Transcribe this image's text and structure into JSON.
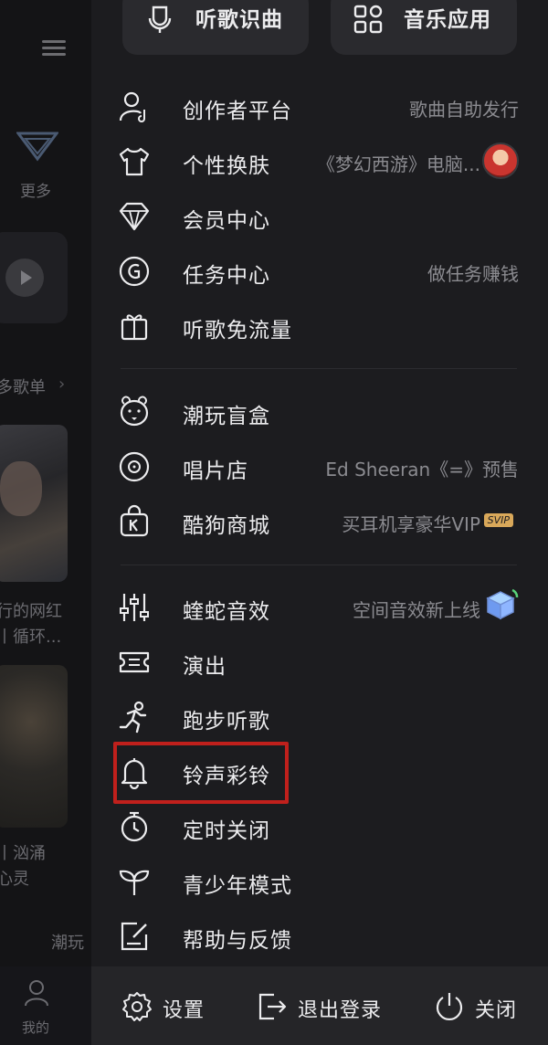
{
  "background": {
    "more_label": "更多",
    "playlist_label": "多歌单",
    "chevron": "›",
    "song1_line1": "行的网红",
    "song1_line2": "丨循环...",
    "song2_line1": "丨汹涌",
    "song2_line2": "心灵",
    "trend_label": "潮玩",
    "me_label": "我的"
  },
  "top": {
    "recognize_label": "听歌识曲",
    "apps_label": "音乐应用"
  },
  "menu": {
    "creator": {
      "label": "创作者平台",
      "hint": "歌曲自助发行"
    },
    "skin": {
      "label": "个性换肤",
      "hint": "《梦幻西游》电脑..."
    },
    "vip": {
      "label": "会员中心"
    },
    "task": {
      "label": "任务中心",
      "hint": "做任务赚钱"
    },
    "free_flow": {
      "label": "听歌免流量"
    },
    "blind_box": {
      "label": "潮玩盲盒"
    },
    "record_store": {
      "label": "唱片店",
      "hint": "Ed Sheeran《=》预售"
    },
    "mall": {
      "label": "酷狗商城",
      "hint": "买耳机享豪华VIP",
      "badge": "SVIP"
    },
    "sound_effect": {
      "label": "蝰蛇音效",
      "hint": "空间音效新上线"
    },
    "show": {
      "label": "演出"
    },
    "running": {
      "label": "跑步听歌"
    },
    "ringtone": {
      "label": "铃声彩铃"
    },
    "timer": {
      "label": "定时关闭"
    },
    "youth": {
      "label": "青少年模式"
    },
    "help": {
      "label": "帮助与反馈"
    }
  },
  "bottom": {
    "settings_label": "设置",
    "logout_label": "退出登录",
    "close_label": "关闭"
  },
  "colors": {
    "drawer_bg": "#1c1c1f",
    "highlight": "#c0201c",
    "text": "#ececee",
    "hint": "#8b8b90"
  }
}
